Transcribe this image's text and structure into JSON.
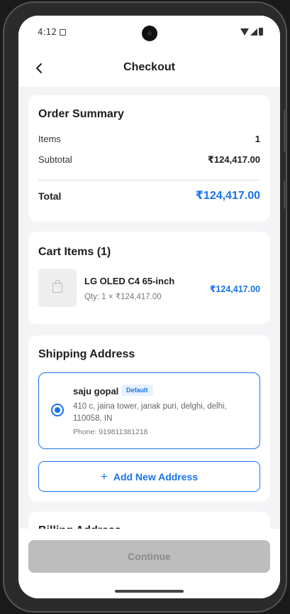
{
  "status_bar": {
    "time": "4:12"
  },
  "header": {
    "title": "Checkout"
  },
  "order_summary": {
    "title": "Order Summary",
    "items_label": "Items",
    "items_value": "1",
    "subtotal_label": "Subtotal",
    "subtotal_value": "₹124,417.00",
    "total_label": "Total",
    "total_value": "₹124,417.00"
  },
  "cart": {
    "title": "Cart Items (1)",
    "items": [
      {
        "name": "LG OLED C4 65-inch",
        "qty": "Qty: 1 × ₹124,417.00",
        "price": "₹124,417.00"
      }
    ]
  },
  "shipping": {
    "title": "Shipping Address",
    "address": {
      "name": "saju gopal",
      "badge": "Default",
      "line": "410 c, jaina tower, janak puri, delghi, delhi, 110058, IN",
      "phone": "Phone: 919811381218",
      "selected": true
    },
    "add_button": "Add New Address"
  },
  "billing": {
    "title": "Billing Address"
  },
  "footer": {
    "continue_label": "Continue"
  },
  "colors": {
    "accent": "#1a73e8",
    "disabled": "#bdbdbd"
  },
  "icons": [
    "back-arrow-icon",
    "shopping-bag-icon",
    "radio-selected-icon",
    "plus-icon"
  ]
}
